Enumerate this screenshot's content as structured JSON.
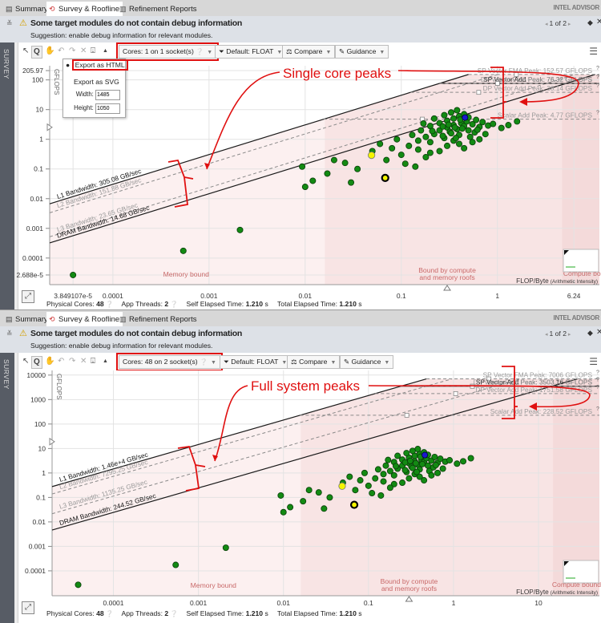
{
  "brand": "INTEL ADVISOR",
  "tabs": [
    {
      "label": "Summary",
      "icon": "clipboard-icon"
    },
    {
      "label": "Survey & Roofline",
      "icon": "roofline-icon",
      "active": true
    },
    {
      "label": "Refinement Reports",
      "icon": "report-icon"
    }
  ],
  "colors": {
    "annotation": "#e01010",
    "point": "#138a13",
    "point_highlight": "#f5f500",
    "point_selected": "#1a1acc",
    "warning": "#d4a000"
  },
  "panels": [
    {
      "warning": {
        "title": "Some target modules do not contain debug information",
        "suggestion": "Suggestion: enable debug information for relevant modules.",
        "pager": "1 of 2"
      },
      "side_label": "SURVEY",
      "toolbar": {
        "cores": "Cores:  1 on 1 socket(s)",
        "filter": "Default: FLOAT",
        "compare": "Compare",
        "guidance": "Guidance"
      },
      "export_menu": {
        "html": "Export as HTML",
        "svg": "Export as SVG",
        "width_label": "Width:",
        "width": "1485",
        "height_label": "Height:",
        "height": "1050"
      },
      "annotation": "Single core peaks",
      "footer": {
        "cores_label": "Physical Cores:",
        "cores": "48",
        "threads_label": "App Threads:",
        "threads": "2",
        "self_label": "Self Elapsed Time:",
        "self": "1.210",
        "total_label": "Total Elapsed Time:",
        "total": "1.210",
        "unit": "s"
      },
      "chart": {
        "type": "scatter",
        "ylabel": "GFLOPS",
        "xlabel": "FLOP/Byte",
        "xlabel_sub": "(Arithmetic Intensity)",
        "xscale": "log",
        "yscale": "log",
        "xlim": [
          2.2e-05,
          11.5
        ],
        "ylim": [
          1.27e-05,
          300
        ],
        "x_ticks": [
          {
            "v": 3.849107e-05,
            "t": "3.849107e-5"
          },
          {
            "v": 0.0001,
            "t": "0.0001"
          },
          {
            "v": 0.001,
            "t": "0.001"
          },
          {
            "v": 0.01,
            "t": "0.01"
          },
          {
            "v": 0.1,
            "t": "0.1"
          },
          {
            "v": 1,
            "t": "1"
          },
          {
            "v": 6.24,
            "t": "6.24"
          }
        ],
        "y_ticks": [
          {
            "v": 205.97,
            "t": "205.97"
          },
          {
            "v": 100,
            "t": "100"
          },
          {
            "v": 10,
            "t": "10"
          },
          {
            "v": 1,
            "t": "1"
          },
          {
            "v": 0.1,
            "t": "0.1"
          },
          {
            "v": 0.01,
            "t": "0.01"
          },
          {
            "v": 0.001,
            "t": "0.001"
          },
          {
            "v": 0.0001,
            "t": "0.0001"
          },
          {
            "v": 2.688e-05,
            "t": "2.688e-5"
          }
        ],
        "memory_roofs": [
          {
            "label": "L1 Bandwidth: 305.08 GB/sec",
            "value": 305.08,
            "style": "solid"
          },
          {
            "label": "L2 Bandwidth: 151.88 GB/sec",
            "value": 151.88,
            "style": "dashed"
          },
          {
            "label": "L3 Bandwidth: 23.65 GB/sec",
            "value": 23.65,
            "style": "dashed"
          },
          {
            "label": "DRAM Bandwidth: 14.68 GB/sec",
            "value": 14.68,
            "style": "solid"
          }
        ],
        "compute_roofs": [
          {
            "label": "SP Vector FMA Peak: 152.57 GFLOPS",
            "value": 152.57,
            "style": "dashed"
          },
          {
            "label": "SP Vector Add Peak: 76.32 GFLOPS",
            "value": 76.32,
            "style": "solid"
          },
          {
            "label": "DP Vector FMA Peak: 76.32 GFLOPS",
            "value": 76.32,
            "style": "dashed"
          },
          {
            "label": "DP Vector Add Peak: 38.14 GFLOPS",
            "value": 38.14,
            "style": "dashed"
          },
          {
            "label": "Scalar Add Peak: 4.77 GFLOPS",
            "value": 4.77,
            "style": "dashed"
          }
        ],
        "regions": {
          "bound_start": 0.016,
          "compute_start": 4.7,
          "memory_label": "Memory bound",
          "mixed_label_1": "Bound by compute",
          "mixed_label_2": "and memory roofs",
          "compute_label": "Compute bound"
        }
      }
    },
    {
      "warning": {
        "title": "Some target modules do not contain debug information",
        "suggestion": "Suggestion: enable debug information for relevant modules.",
        "pager": "1 of 2"
      },
      "side_label": "SURVEY",
      "toolbar": {
        "cores": "Cores:  48 on 2 socket(s)",
        "filter": "Default: FLOAT",
        "compare": "Compare",
        "guidance": "Guidance"
      },
      "annotation": "Full system peaks",
      "footer": {
        "cores_label": "Physical Cores:",
        "cores": "48",
        "threads_label": "App Threads:",
        "threads": "2",
        "self_label": "Self Elapsed Time:",
        "self": "1.210",
        "total_label": "Total Elapsed Time:",
        "total": "1.210",
        "unit": "s"
      },
      "chart": {
        "type": "scatter",
        "ylabel": "GFLOPS",
        "xlabel": "FLOP/Byte",
        "xlabel_sub": "(Arithmetic Intensity)",
        "xscale": "log",
        "yscale": "log",
        "xlim": [
          1.9e-05,
          52
        ],
        "ylim": [
          9.6e-06,
          15500
        ],
        "x_ticks": [
          {
            "v": 0.0001,
            "t": "0.0001"
          },
          {
            "v": 0.001,
            "t": "0.001"
          },
          {
            "v": 0.01,
            "t": "0.01"
          },
          {
            "v": 0.1,
            "t": "0.1"
          },
          {
            "v": 1,
            "t": "1"
          },
          {
            "v": 10,
            "t": "10"
          }
        ],
        "y_ticks": [
          {
            "v": 10000,
            "t": "10000"
          },
          {
            "v": 1000,
            "t": "1000"
          },
          {
            "v": 100,
            "t": "100"
          },
          {
            "v": 10,
            "t": "10"
          },
          {
            "v": 1,
            "t": "1"
          },
          {
            "v": 0.1,
            "t": "0.1"
          },
          {
            "v": 0.01,
            "t": "0.01"
          },
          {
            "v": 0.001,
            "t": "0.001"
          },
          {
            "v": 0.0001,
            "t": "0.0001"
          }
        ],
        "memory_roofs": [
          {
            "label": "L1 Bandwidth: 1.46e+4 GB/sec",
            "value": 14600,
            "style": "solid"
          },
          {
            "label": "L2 Bandwidth: 7295.25 GB/sec",
            "value": 7295.25,
            "style": "dashed"
          },
          {
            "label": "L3 Bandwidth: 1135.25 GB/sec",
            "value": 1135.25,
            "style": "dashed"
          },
          {
            "label": "DRAM Bandwidth: 244.52 GB/sec",
            "value": 244.52,
            "style": "solid"
          }
        ],
        "compute_roofs": [
          {
            "label": "SP Vector FMA Peak: 7006 GFLOPS",
            "value": 7006,
            "style": "dashed"
          },
          {
            "label": "SP Vector Add Peak: 3503.16 GFLOPS",
            "value": 3503.16,
            "style": "solid"
          },
          {
            "label": "DP Vector FMA Peak: 3503.72 GFLOPS",
            "value": 3503.72,
            "style": "dashed"
          },
          {
            "label": "DP Vector Add Peak: 1751.58 GFLOPS",
            "value": 1751.58,
            "style": "dashed"
          },
          {
            "label": "Scalar Add Peak: 228.52 GFLOPS",
            "value": 228.52,
            "style": "dashed"
          }
        ],
        "regions": {
          "bound_start": 0.016,
          "compute_start": 14.8,
          "memory_label": "Memory bound",
          "mixed_label_1": "Bound by compute",
          "mixed_label_2": "and memory roofs",
          "compute_label": "Compute bound"
        }
      }
    }
  ],
  "chart_data": {
    "type": "scatter",
    "xlabel": "FLOP/Byte (Arithmetic Intensity)",
    "ylabel": "GFLOPS",
    "points": [
      [
        3.849e-05,
        2.688e-05
      ],
      [
        0.00054,
        0.000175
      ],
      [
        0.0021,
        0.00088
      ],
      [
        0.0093,
        0.12
      ],
      [
        0.01,
        0.025
      ],
      [
        0.017,
        0.07
      ],
      [
        0.026,
        0.16
      ],
      [
        0.012,
        0.04
      ],
      [
        0.02,
        0.2
      ],
      [
        0.03,
        0.035
      ],
      [
        0.035,
        0.1
      ],
      [
        0.12,
        0.6
      ],
      [
        0.15,
        0.9
      ],
      [
        0.18,
        1.2
      ],
      [
        0.2,
        0.8
      ],
      [
        0.22,
        1.5
      ],
      [
        0.25,
        2
      ],
      [
        0.28,
        1.1
      ],
      [
        0.3,
        2.5
      ],
      [
        0.32,
        1.8
      ],
      [
        0.35,
        3
      ],
      [
        0.38,
        2.2
      ],
      [
        0.4,
        1.4
      ],
      [
        0.42,
        3.5
      ],
      [
        0.45,
        2.8
      ],
      [
        0.48,
        4
      ],
      [
        0.5,
        2
      ],
      [
        0.55,
        3.2
      ],
      [
        0.6,
        4.5
      ],
      [
        0.65,
        2.6
      ],
      [
        0.7,
        3.8
      ],
      [
        0.2,
        2.8
      ],
      [
        0.25,
        3.5
      ],
      [
        0.3,
        4.2
      ],
      [
        0.35,
        5
      ],
      [
        0.4,
        6
      ],
      [
        0.45,
        7
      ],
      [
        0.5,
        5.5
      ],
      [
        0.3,
        0.6
      ],
      [
        0.35,
        0.9
      ],
      [
        0.4,
        0.7
      ],
      [
        0.25,
        0.4
      ],
      [
        0.2,
        0.35
      ],
      [
        0.15,
        0.45
      ],
      [
        0.18,
        0.25
      ],
      [
        0.1,
        0.3
      ],
      [
        0.13,
        1.4
      ],
      [
        0.16,
        2
      ],
      [
        0.21,
        1.9
      ],
      [
        0.27,
        1.3
      ],
      [
        0.33,
        1.6
      ],
      [
        0.37,
        1.1
      ],
      [
        0.43,
        2.3
      ],
      [
        0.52,
        1.2
      ],
      [
        0.58,
        1.7
      ],
      [
        0.62,
        2.1
      ],
      [
        0.75,
        1.5
      ],
      [
        0.8,
        2.9
      ],
      [
        0.9,
        3.3
      ],
      [
        1.1,
        2.4
      ],
      [
        1.3,
        3
      ],
      [
        1.6,
        4
      ],
      [
        0.28,
        6.5
      ],
      [
        0.33,
        8
      ],
      [
        0.38,
        9.5
      ],
      [
        0.22,
        5
      ],
      [
        0.17,
        3.4
      ],
      [
        0.09,
        1
      ],
      [
        0.08,
        0.5
      ],
      [
        0.07,
        0.2
      ],
      [
        0.11,
        0.15
      ],
      [
        0.14,
        0.12
      ],
      [
        0.06,
        0.7
      ],
      [
        0.05,
        0.4
      ],
      [
        0.45,
        0.5
      ],
      [
        0.55,
        0.8
      ],
      [
        0.65,
        1
      ],
      [
        0.27,
        2.7
      ],
      [
        0.31,
        3.1
      ],
      [
        0.36,
        2.5
      ],
      [
        0.41,
        4.6
      ]
    ],
    "highlighted_points": [
      {
        "x": 0.049,
        "y": 0.29,
        "kind": "yellow"
      },
      {
        "x": 0.068,
        "y": 0.05,
        "kind": "ringed"
      },
      {
        "x": 0.46,
        "y": 5.4,
        "kind": "blue"
      }
    ]
  }
}
